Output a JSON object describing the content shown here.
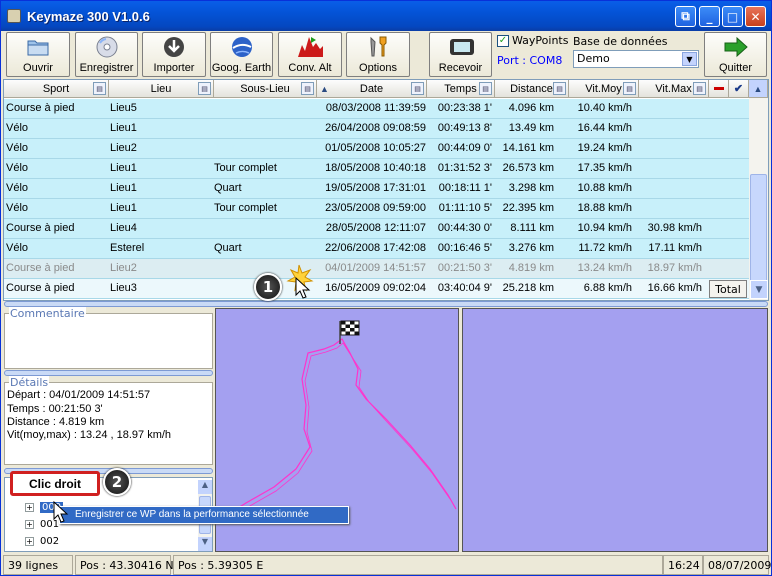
{
  "window": {
    "title": "Keymaze 300 V1.0.6"
  },
  "toolbar": {
    "ouvrir": "Ouvrir",
    "enregistrer": "Enregistrer",
    "importer": "Importer",
    "google_earth": "Goog. Earth",
    "conv_alt": "Conv. Alt",
    "options": "Options",
    "recevoir": "Recevoir",
    "quitter": "Quitter",
    "waypoints_label": "WayPoints",
    "waypoints_checked": true,
    "port": "Port : COM8",
    "db_label": "Base de données",
    "db_value": "Demo"
  },
  "table": {
    "columns": [
      "Sport",
      "Lieu",
      "Sous-Lieu",
      "Date",
      "Temps",
      "Distance",
      "Vit.Moy",
      "Vit.Max"
    ],
    "rows": [
      {
        "sport": "Course à pied",
        "lieu": "Lieu5",
        "souslieu": "",
        "date": "08/03/2008 11:39:59",
        "temps": "00:23:38 1'",
        "distance": "4.096 km",
        "vmoy": "10.40 km/h",
        "vmax": ""
      },
      {
        "sport": "Vélo",
        "lieu": "Lieu1",
        "souslieu": "",
        "date": "26/04/2008 09:08:59",
        "temps": "00:49:13 8'",
        "distance": "13.49 km",
        "vmoy": "16.44 km/h",
        "vmax": ""
      },
      {
        "sport": "Vélo",
        "lieu": "Lieu2",
        "souslieu": "",
        "date": "01/05/2008 10:05:27",
        "temps": "00:44:09 0'",
        "distance": "14.161 km",
        "vmoy": "19.24 km/h",
        "vmax": ""
      },
      {
        "sport": "Vélo",
        "lieu": "Lieu1",
        "souslieu": "Tour complet",
        "date": "18/05/2008 10:40:18",
        "temps": "01:31:52 3'",
        "distance": "26.573 km",
        "vmoy": "17.35 km/h",
        "vmax": ""
      },
      {
        "sport": "Vélo",
        "lieu": "Lieu1",
        "souslieu": "Quart",
        "date": "19/05/2008 17:31:01",
        "temps": "00:18:11 1'",
        "distance": "3.298 km",
        "vmoy": "10.88 km/h",
        "vmax": ""
      },
      {
        "sport": "Vélo",
        "lieu": "Lieu1",
        "souslieu": "Tour complet",
        "date": "23/05/2008 09:59:00",
        "temps": "01:11:10 5'",
        "distance": "22.395 km",
        "vmoy": "18.88 km/h",
        "vmax": ""
      },
      {
        "sport": "Course à pied",
        "lieu": "Lieu4",
        "souslieu": "",
        "date": "28/05/2008 12:11:07",
        "temps": "00:44:30 0'",
        "distance": "8.111 km",
        "vmoy": "10.94 km/h",
        "vmax": "30.98 km/h"
      },
      {
        "sport": "Vélo",
        "lieu": "Esterel",
        "souslieu": "Quart",
        "date": "22/06/2008 17:42:08",
        "temps": "00:16:46 5'",
        "distance": "3.276 km",
        "vmoy": "11.72 km/h",
        "vmax": "17.11 km/h"
      },
      {
        "sport": "Course à pied",
        "lieu": "Lieu2",
        "souslieu": "",
        "date": "04/01/2009 14:51:57",
        "temps": "00:21:50 3'",
        "distance": "4.819 km",
        "vmoy": "13.24 km/h",
        "vmax": "18.97 km/h"
      },
      {
        "sport": "Course à pied",
        "lieu": "Lieu3",
        "souslieu": "",
        "date": "16/05/2009 09:02:04",
        "temps": "03:40:04 9'",
        "distance": "25.218 km",
        "vmoy": "6.88 km/h",
        "vmax": "16.66 km/h"
      }
    ],
    "total_label": "Total"
  },
  "panels": {
    "comment_label": "Commentaire",
    "details_label": "Détails",
    "details": {
      "depart": "Départ : 04/01/2009 14:51:57",
      "temps": "Temps : 00:21:50 3'",
      "distance": "Distance : 4.819 km",
      "vit": "Vit(moy,max) : 13.24 , 18.97 km/h"
    },
    "tree": [
      "000",
      "001",
      "002"
    ]
  },
  "annotations": {
    "callout1": "1",
    "callout2": "2",
    "clic_droit": "Clic droit",
    "context_menu_item": "Enregistrer ce WP dans la performance sélectionnée"
  },
  "status": {
    "lines": "39 lignes",
    "pos_n": "Pos : 43.30416 N",
    "pos_e": "Pos : 5.39305 E",
    "time": "16:24",
    "date": "08/07/2009"
  },
  "colors": {
    "track": "#ff33cc",
    "map_bg": "#a4a0f0",
    "row_bg": "#c8f0fa",
    "titlebar": "#0453d6"
  }
}
